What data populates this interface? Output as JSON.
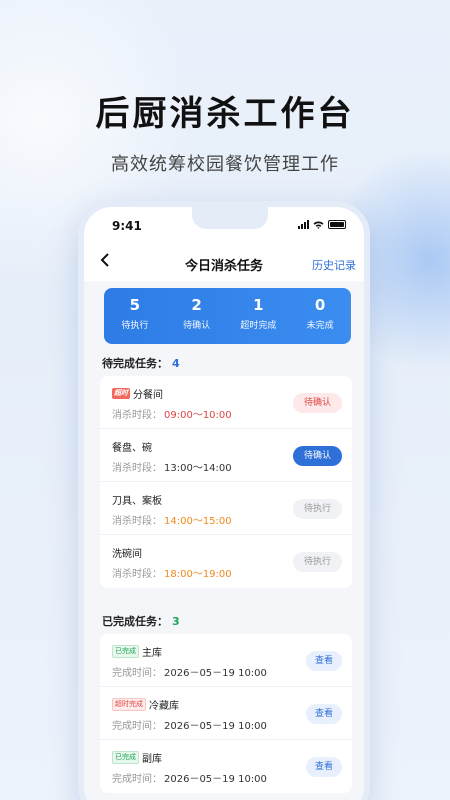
{
  "headline": "后厨消杀工作台",
  "subline": "高效统筹校园餐饮管理工作",
  "status_bar": {
    "time": "9:41",
    "icons": [
      "signal-icon",
      "wifi-icon",
      "battery-icon"
    ]
  },
  "nav": {
    "back_icon": "chevron-left-icon",
    "title": "今日消杀任务",
    "history": "历史记录"
  },
  "stats": [
    {
      "value": "5",
      "label": "待执行"
    },
    {
      "value": "2",
      "label": "待确认"
    },
    {
      "value": "1",
      "label": "超时完成"
    },
    {
      "value": "0",
      "label": "未完成"
    }
  ],
  "pending": {
    "title": "待完成任务：",
    "count": "4",
    "time_label": "消杀时段：",
    "items": [
      {
        "tag": "超时",
        "name": "分餐间",
        "time": "09:00～10:00",
        "action": "待确认"
      },
      {
        "name": "餐盘、碗",
        "time": "13:00～14:00",
        "action": "待确认"
      },
      {
        "name": "刀具、案板",
        "time": "14:00～15:00",
        "action": "待执行"
      },
      {
        "name": "洗碗间",
        "time": "18:00～19:00",
        "action": "待执行"
      }
    ]
  },
  "completed": {
    "title": "已完成任务：",
    "count": "3",
    "time_label": "完成时间：",
    "items": [
      {
        "tag": "已完成",
        "name": "主库",
        "time": "2026－05－19 10:00",
        "action": "查看"
      },
      {
        "tag": "超时完成",
        "name": "冷藏库",
        "time": "2026－05－19 10:00",
        "action": "查看"
      },
      {
        "tag": "已完成",
        "name": "副库",
        "time": "2026－05－19 10:00",
        "action": "查看"
      }
    ]
  },
  "colors": {
    "primary": "#2f6fd8",
    "danger": "#e04545",
    "warning": "#f08a1e",
    "success": "#21a558"
  }
}
